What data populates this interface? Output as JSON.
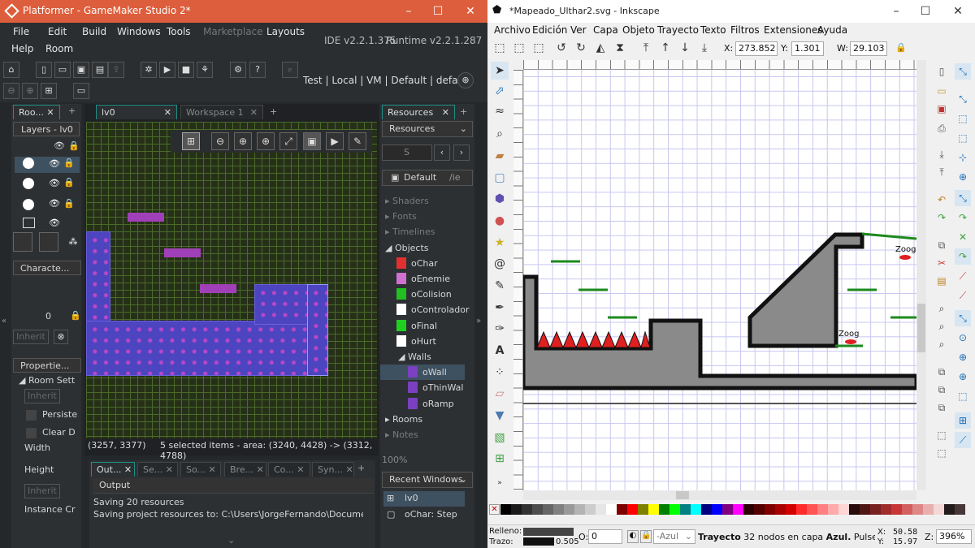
{
  "gm": {
    "title": "Platformer - GameMaker Studio 2*",
    "menu": [
      "File",
      "Edit",
      "Build",
      "Windows",
      "Tools",
      "Marketplace",
      "Layouts",
      "Help",
      "Room"
    ],
    "ide_version": "IDE v2.2.1.375",
    "runtime_version": "Runtime v2.2.1.287",
    "target": {
      "test": "Test",
      "local": "Local",
      "vm": "VM",
      "default1": "Default",
      "default2": "default"
    },
    "left": {
      "tab_room": "Roo...",
      "layers_label": "Layers - lv0",
      "characters_tab": "Characte...",
      "value_zero": "0",
      "inherit": "Inherit",
      "properties_tab": "Propertie...",
      "room_settings": "Room Sett",
      "persistent": "Persiste",
      "clear_display": "Clear D",
      "width": "Width",
      "height": "Height",
      "inherit2": "Inherit",
      "inherit3": "Inherit",
      "instance_creation": "Instance Cr"
    },
    "workspace": {
      "tab_active": "lv0",
      "tab_inactive": "Workspace 1",
      "coords": "(3257, 3377)",
      "selection": "5 selected items - area: (3240, 4428) -> (3312, 4788)"
    },
    "output": {
      "tabs": [
        "Out...",
        "Se...",
        "So...",
        "Bre...",
        "Co...",
        "Syn..."
      ],
      "header": "Output",
      "lines": [
        "Saving 20 resources",
        "Saving project resources to: C:\\Users\\JorgeFernando\\Documents\\G"
      ]
    },
    "resources": {
      "tab": "Resources",
      "dropdown": "Resources",
      "search_placeholder": "S",
      "config": "Default",
      "config_suffix": "/ie",
      "items": [
        {
          "label": "Shaders",
          "kind": "folder",
          "dim": true
        },
        {
          "label": "Fonts",
          "kind": "folder",
          "dim": true
        },
        {
          "label": "Timelines",
          "kind": "folder",
          "dim": true
        },
        {
          "label": "Objects",
          "kind": "folder-open"
        },
        {
          "label": "oChar",
          "kind": "obj",
          "color": "#e03030"
        },
        {
          "label": "oEnemie",
          "kind": "obj",
          "color": "#d070d0"
        },
        {
          "label": "oColision",
          "kind": "obj",
          "color": "#20c020"
        },
        {
          "label": "oControlador",
          "kind": "obj",
          "color": "#ffffff"
        },
        {
          "label": "oFinal",
          "kind": "obj",
          "color": "#20d020"
        },
        {
          "label": "oHurt",
          "kind": "obj",
          "color": "#ffffff"
        },
        {
          "label": "Walls",
          "kind": "subfolder"
        },
        {
          "label": "oWall",
          "kind": "obj2",
          "color": "#7a40c0",
          "selected": true
        },
        {
          "label": "oThinWal",
          "kind": "obj2",
          "color": "#7a40c0"
        },
        {
          "label": "oRamp",
          "kind": "obj2",
          "color": "#7a40c0"
        },
        {
          "label": "Rooms",
          "kind": "folder"
        },
        {
          "label": "Notes",
          "kind": "folder",
          "dim": true
        }
      ],
      "zoom": "100%",
      "recent_title": "Recent Windows",
      "recent": [
        "lv0",
        "oChar: Step"
      ]
    }
  },
  "ink": {
    "title": "*Mapeado_Ulthar2.svg - Inkscape",
    "menu": [
      "Archivo",
      "Edición",
      "Ver",
      "Capa",
      "Objeto",
      "Trayecto",
      "Texto",
      "Filtros",
      "Extensiones",
      "Ayuda"
    ],
    "x_label": "X:",
    "x_value": "273.852",
    "y_label": "Y:",
    "y_value": "1.301",
    "w_label": "W:",
    "w_value": "29.103",
    "labels": {
      "zoog1": "Zoog",
      "zoog2": "Zoog"
    },
    "status": {
      "fill_label": "Relleno:",
      "stroke_label": "Trazo:",
      "stroke_width": "0.505",
      "opacity_label": "O:",
      "opacity_value": "0",
      "layer": "-Azul",
      "message_bold": "Trayecto",
      "message": "32 nodos en capa",
      "message_layer": "Azul.",
      "message_tail": "Pulse en la",
      "x_label": "X:",
      "x_val": "50.58",
      "y_label": "Y:",
      "y_val": "15.97",
      "zoom_label": "Z:",
      "zoom": "396%"
    },
    "palette": [
      "#000000",
      "#1a1a1a",
      "#333333",
      "#4d4d4d",
      "#666666",
      "#808080",
      "#999999",
      "#b3b3b3",
      "#cccccc",
      "#e6e6e6",
      "#ffffff",
      "#800000",
      "#ff0000",
      "#808000",
      "#ffff00",
      "#008000",
      "#00ff00",
      "#008080",
      "#00ffff",
      "#000080",
      "#0000ff",
      "#800080",
      "#ff00ff",
      "#2b0000",
      "#550000",
      "#800000",
      "#aa0000",
      "#d40000",
      "#ff2a2a",
      "#ff5555",
      "#ff8080",
      "#ffaaaa",
      "#ffd5d5",
      "#280b0b",
      "#501616",
      "#782121",
      "#a02c2c",
      "#c83737",
      "#d35f5f",
      "#de8787",
      "#e9afaf",
      "#f4d7d7",
      "#241c1c",
      "#483737"
    ]
  }
}
